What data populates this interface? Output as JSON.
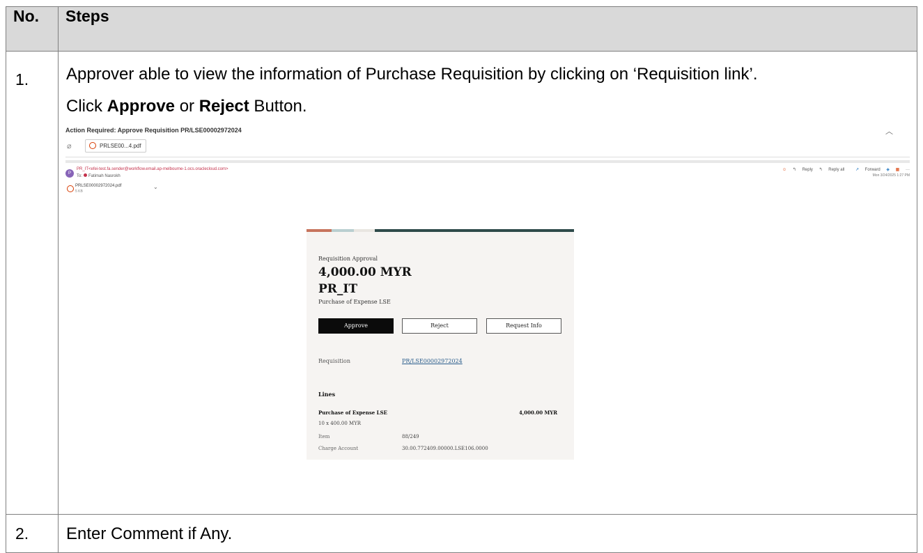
{
  "table": {
    "header": {
      "no": "No.",
      "steps": "Steps"
    },
    "rows": [
      {
        "num": "1.",
        "text1": "Approver able to view the information of Purchase Requisition by clicking on ‘Requisition link’.",
        "text2_pre": "Click ",
        "text2_bold1": "Approve",
        "text2_mid": " or ",
        "text2_bold2": "Reject",
        "text2_post": " Button."
      },
      {
        "num": "2.",
        "text": "Enter Comment if Any."
      }
    ]
  },
  "email": {
    "subject": "Action Required: Approve Requisition PR/LSE00002972024",
    "collapse_icon": "chevron-up-icon",
    "attachment_chip": "PRLSE00...4.pdf",
    "avatar_initial": "P",
    "from": "PR_IT<efei-test.fa.sender@workflow.email.ap-melbourne-1.ocs.oraclecloud.com>",
    "to_label": "To:",
    "to_name": "Fatimah Nasrokh",
    "actions": {
      "reply": "Reply",
      "reply_all": "Reply all",
      "forward": "Forward",
      "more": "···"
    },
    "date": "Mon 3/24/2025 1:27 PM",
    "attachment_file": "PRLSE00002972024.pdf",
    "attachment_size": "5 KB"
  },
  "card": {
    "label": "Requisition Approval",
    "amount": "4,000.00 MYR",
    "code": "PR_IT",
    "description": "Purchase of Expense LSE",
    "buttons": {
      "approve": "Approve",
      "reject": "Reject",
      "request_info": "Request Info"
    },
    "requisition_label": "Requisition",
    "requisition_link": "PR/LSE00002972024",
    "lines_heading": "Lines",
    "line": {
      "name": "Purchase of Expense LSE",
      "amount": "4,000.00 MYR",
      "qty": "10 x 400.00 MYR",
      "item_label": "Item",
      "item_value": "88/249",
      "charge_label": "Charge Account",
      "charge_value": "30.00.772409.00000.LSE106.0000"
    },
    "colors": {
      "approve_bg": "#0b0b0b",
      "link": "#2a5d8c",
      "card_bg": "#f6f4f2"
    }
  }
}
